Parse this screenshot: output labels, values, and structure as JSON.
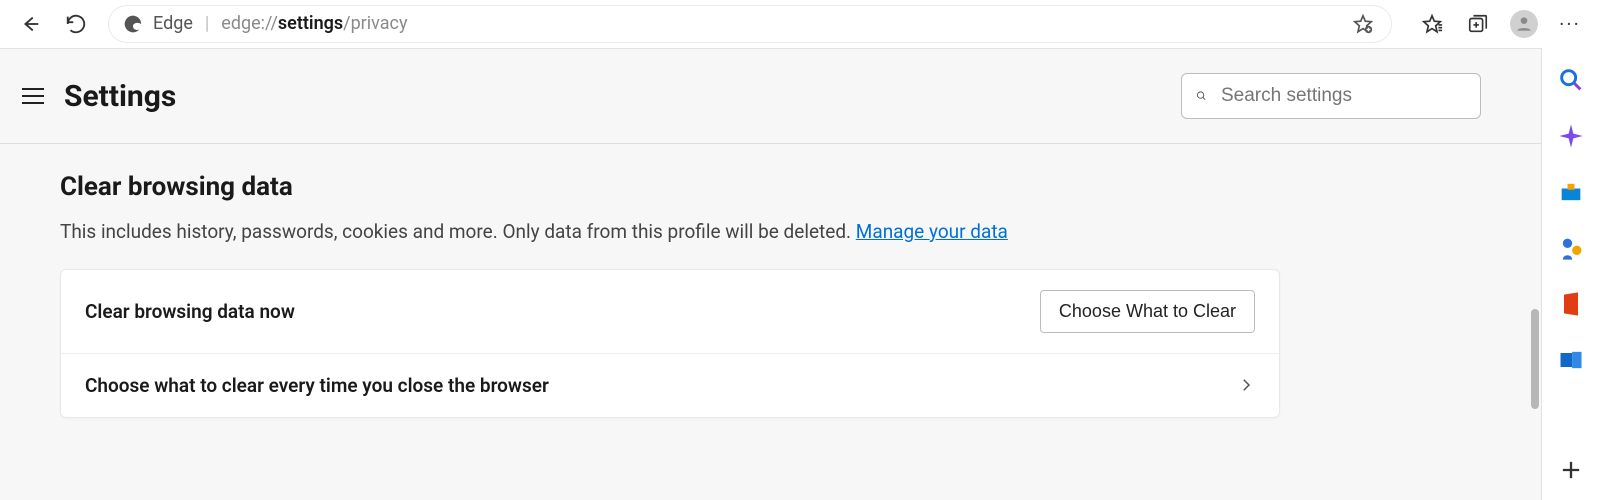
{
  "browser": {
    "app_label": "Edge",
    "url_dim1": "edge://",
    "url_strong": "settings",
    "url_dim2": "/privacy"
  },
  "settings": {
    "title": "Settings",
    "search_placeholder": "Search settings"
  },
  "section": {
    "title": "Clear browsing data",
    "desc_text": "This includes history, passwords, cookies and more. Only data from this profile will be deleted. ",
    "manage_link": "Manage your data"
  },
  "rows": {
    "now_label": "Clear browsing data now",
    "now_button": "Choose What to Clear",
    "close_label": "Choose what to clear every time you close the browser"
  }
}
